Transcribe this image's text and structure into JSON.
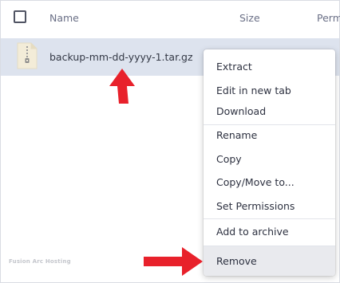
{
  "header": {
    "name_label": "Name",
    "size_label": "Size",
    "perm_label": "Perm"
  },
  "file": {
    "name": "backup-mm-dd-yyyy-1.tar.gz",
    "tail": "y"
  },
  "context_menu": {
    "extract": "Extract",
    "edit_new_tab": "Edit in new tab",
    "download": "Download",
    "rename": "Rename",
    "copy": "Copy",
    "copy_move": "Copy/Move to...",
    "set_permissions": "Set Permissions",
    "add_to_archive": "Add to archive",
    "remove": "Remove"
  },
  "watermark": "Fusion Arc Hosting",
  "colors": {
    "accent_arrow": "#e8212b",
    "row_highlight": "#dde3ee"
  }
}
